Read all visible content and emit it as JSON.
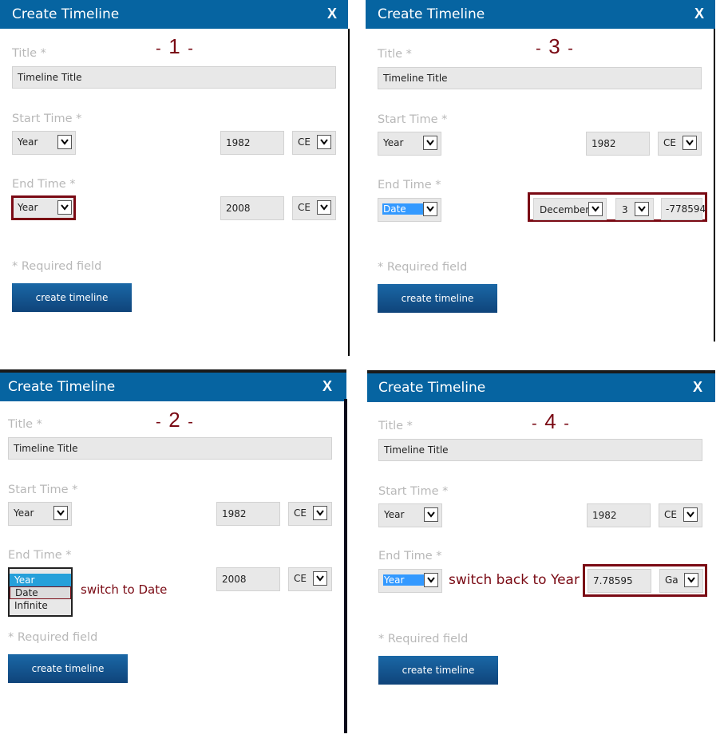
{
  "dialog": {
    "title": "Create Timeline",
    "close_label": "X",
    "title_label": "Title *",
    "start_label": "Start Time *",
    "end_label": "End Time *",
    "required_note": "* Required field",
    "create_button": "create timeline"
  },
  "colors": {
    "header": "#0664a1",
    "annotation": "#7a0a14",
    "selection": "#3399ff"
  },
  "panels": [
    {
      "step": "1",
      "title_value": "Timeline Title",
      "start": {
        "type": "Year",
        "year": "1982",
        "era": "CE"
      },
      "end": {
        "type": "Year",
        "year": "2008",
        "era": "CE"
      }
    },
    {
      "step": "2",
      "title_value": "Timeline Title",
      "start": {
        "type": "Year",
        "year": "1982",
        "era": "CE"
      },
      "end": {
        "type_options": [
          "Year",
          "Date",
          "Infinite"
        ],
        "selected": "Year",
        "hovered": "Date",
        "year": "2008",
        "era": "CE"
      },
      "annotation": "switch to Date"
    },
    {
      "step": "3",
      "title_value": "Timeline Title",
      "start": {
        "type": "Year",
        "year": "1982",
        "era": "CE"
      },
      "end": {
        "type": "Date",
        "month": "December",
        "day": "3",
        "year": "-778594"
      }
    },
    {
      "step": "4",
      "title_value": "Timeline Title",
      "start": {
        "type": "Year",
        "year": "1982",
        "era": "CE"
      },
      "end": {
        "type": "Year",
        "year": "7.78595",
        "era": "Ga"
      },
      "annotation": "switch back to Year"
    }
  ]
}
